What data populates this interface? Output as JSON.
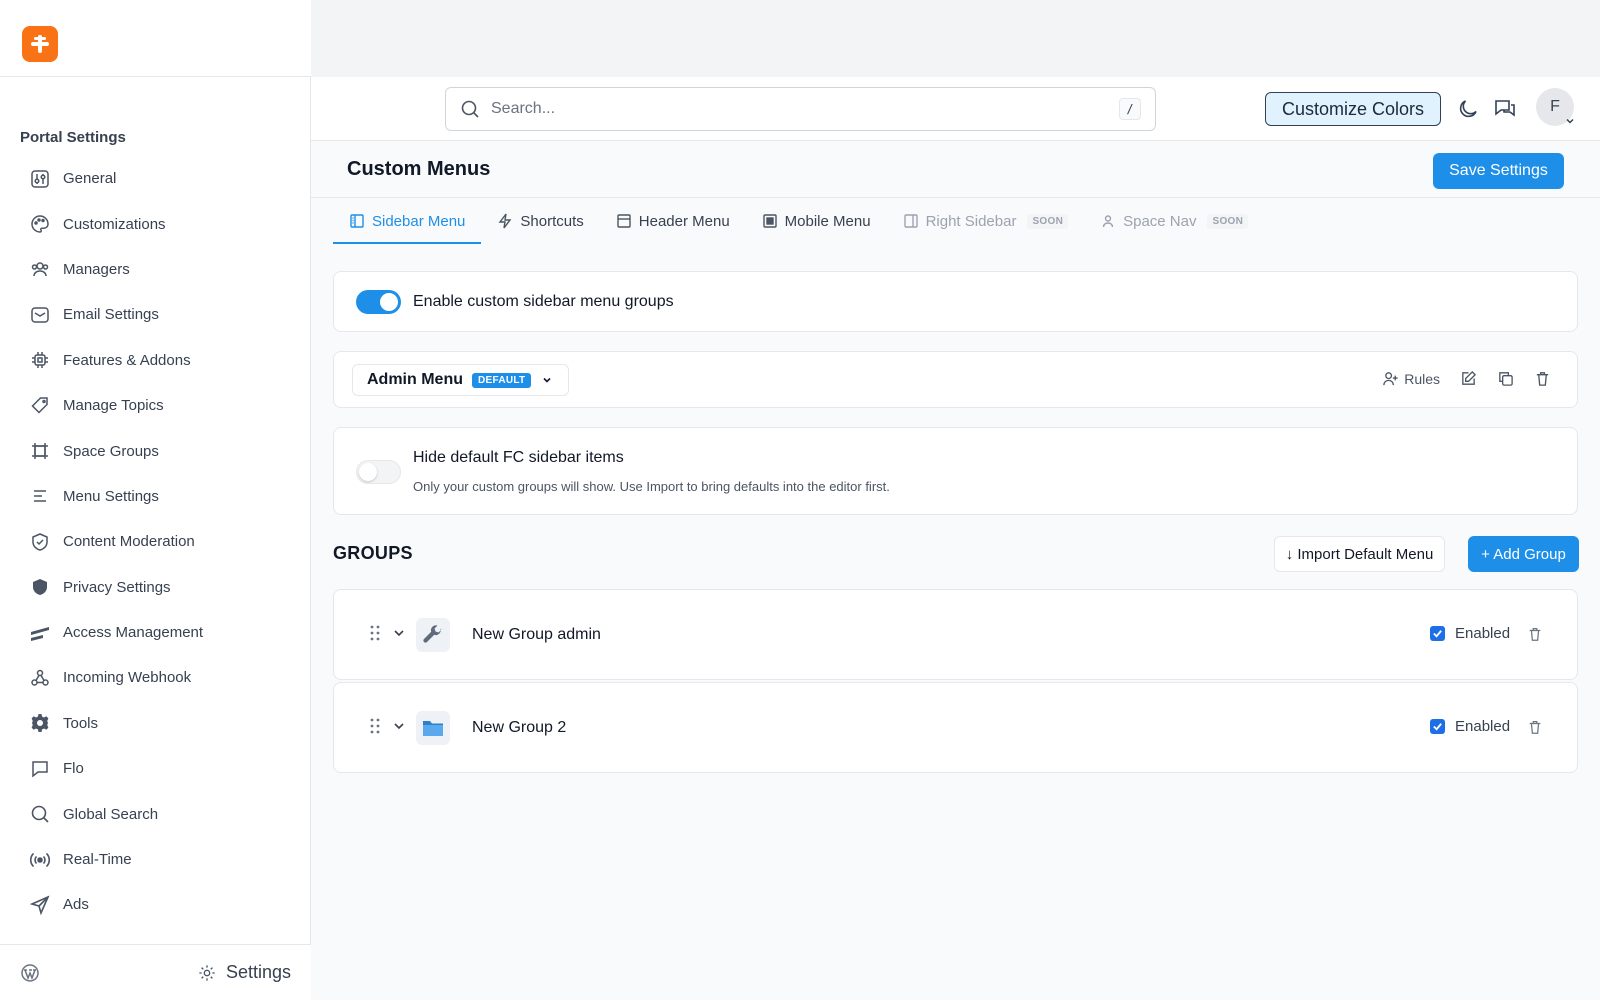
{
  "sidebar": {
    "section_title": "Portal Settings",
    "items": [
      {
        "label": "General",
        "icon": "sliders-icon"
      },
      {
        "label": "Customizations",
        "icon": "palette-icon"
      },
      {
        "label": "Managers",
        "icon": "users-icon"
      },
      {
        "label": "Email Settings",
        "icon": "mail-icon"
      },
      {
        "label": "Features & Addons",
        "icon": "chip-icon"
      },
      {
        "label": "Manage Topics",
        "icon": "tag-icon"
      },
      {
        "label": "Space Groups",
        "icon": "frame-icon"
      },
      {
        "label": "Menu Settings",
        "icon": "menu-lines-icon"
      },
      {
        "label": "Content Moderation",
        "icon": "shield-check-icon"
      },
      {
        "label": "Privacy Settings",
        "icon": "shield-icon"
      },
      {
        "label": "Access Management",
        "icon": "access-stripes-icon"
      },
      {
        "label": "Incoming Webhook",
        "icon": "webhook-icon"
      },
      {
        "label": "Tools",
        "icon": "gear-icon"
      },
      {
        "label": "Flo",
        "icon": "chat-icon"
      },
      {
        "label": "Global Search",
        "icon": "search-icon"
      },
      {
        "label": "Real-Time",
        "icon": "broadcast-icon"
      },
      {
        "label": "Ads",
        "icon": "send-icon"
      }
    ],
    "footer": {
      "settings_label": "Settings"
    }
  },
  "header": {
    "search_placeholder": "Search...",
    "search_shortcut": "/",
    "customize_label": "Customize Colors",
    "avatar_initial": "F"
  },
  "main": {
    "title": "Custom Menus",
    "save_label": "Save Settings",
    "tabs": [
      {
        "label": "Sidebar Menu",
        "badge": ""
      },
      {
        "label": "Shortcuts",
        "badge": ""
      },
      {
        "label": "Header Menu",
        "badge": ""
      },
      {
        "label": "Mobile Menu",
        "badge": ""
      },
      {
        "label": "Right Sidebar",
        "badge": "SOON"
      },
      {
        "label": "Space Nav",
        "badge": "SOON"
      }
    ],
    "enable_toggle": {
      "label": "Enable custom sidebar menu groups",
      "on": true
    },
    "menu_select": {
      "name": "Admin Menu",
      "badge": "DEFAULT",
      "rules_label": "Rules"
    },
    "hide_default": {
      "title": "Hide default FC sidebar items",
      "description": "Only your custom groups will show. Use Import to bring defaults into the editor first.",
      "on": false
    },
    "groups_heading": "GROUPS",
    "import_label": "↓ Import Default Menu",
    "add_group_label": "+ Add Group",
    "groups": [
      {
        "name": "New Group admin",
        "icon": "wrench-icon",
        "enabled_label": "Enabled",
        "enabled": true
      },
      {
        "name": "New Group 2",
        "icon": "folder-icon",
        "enabled_label": "Enabled",
        "enabled": true
      }
    ]
  },
  "colors": {
    "accent": "#1d8fe8",
    "brand": "#f97316"
  }
}
